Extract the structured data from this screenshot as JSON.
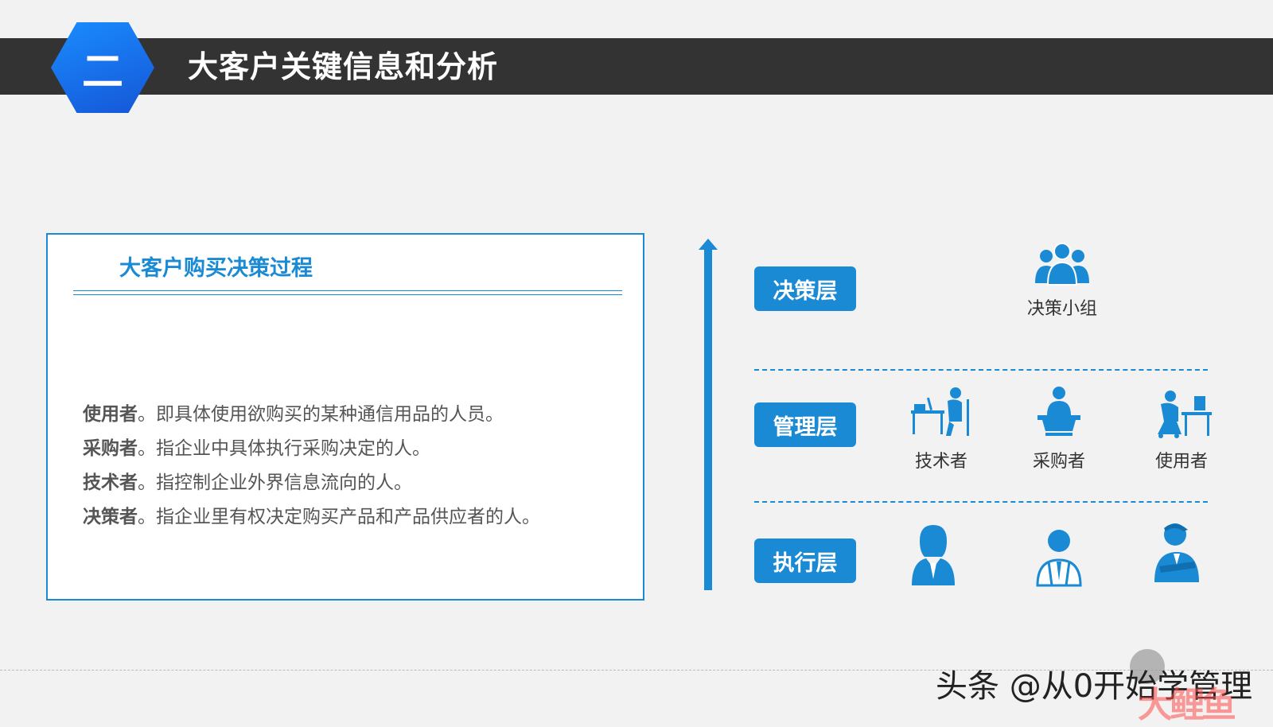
{
  "header": {
    "section_number": "二",
    "title": "大客户关键信息和分析"
  },
  "card": {
    "title": "大客户购买决策过程",
    "definitions": [
      {
        "term": "使用者",
        "text": "。即具体使用欲购买的某种通信用品的人员。"
      },
      {
        "term": "采购者",
        "text": "。指企业中具体执行采购决定的人。"
      },
      {
        "term": "技术者",
        "text": "。指控制企业外界信息流向的人。"
      },
      {
        "term": "决策者",
        "text": "。指企业里有权决定购买产品和产品供应者的人。"
      }
    ]
  },
  "levels": [
    "决策层",
    "管理层",
    "执行层"
  ],
  "decision": {
    "label": "决策小组",
    "icon": "group-icon"
  },
  "management": [
    {
      "label": "技术者",
      "icon": "technician-at-desk-icon"
    },
    {
      "label": "采购者",
      "icon": "buyer-at-podium-icon"
    },
    {
      "label": "使用者",
      "icon": "user-at-computer-icon"
    }
  ],
  "execution": [
    {
      "icon": "female-staff-icon"
    },
    {
      "icon": "male-staff-outline-icon"
    },
    {
      "icon": "male-staff-arms-crossed-icon"
    }
  ],
  "watermark": {
    "text": "头条 @从0开始学管理",
    "logo_text": "大鲤鱼"
  },
  "colors": {
    "accent": "#1a8ad4",
    "header_bg": "#333333",
    "badge_blue": "#1556d6"
  }
}
